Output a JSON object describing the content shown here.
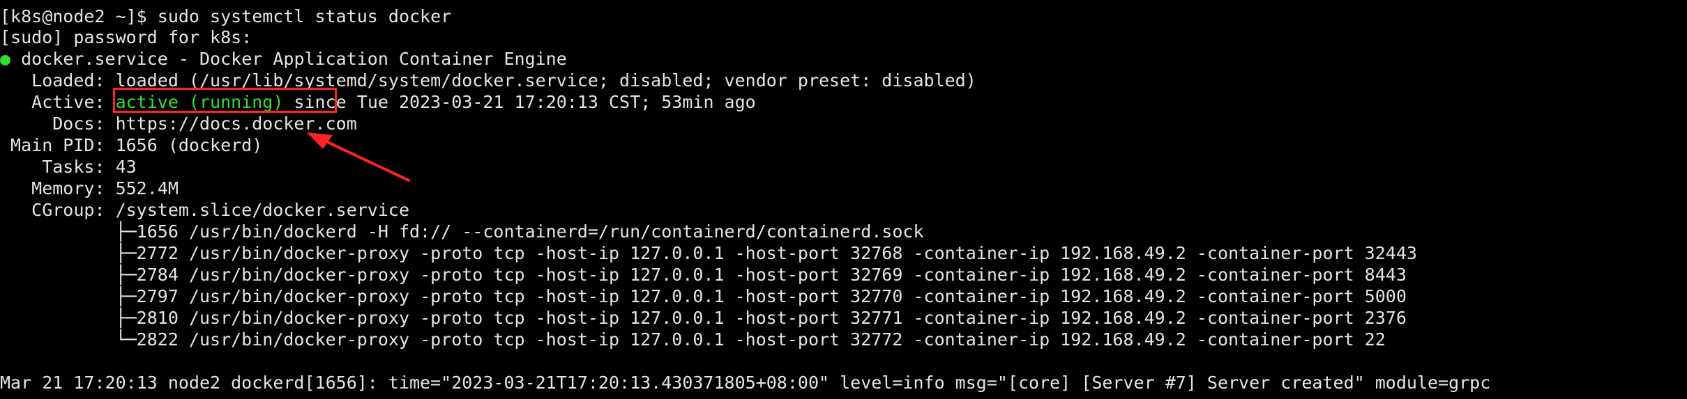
{
  "terminal": {
    "lines": [
      {
        "text": "[k8s@node2 ~]$ sudo systemctl status docker"
      },
      {
        "text": "[sudo] password for k8s:"
      },
      {
        "bullet": "●",
        "text": " docker.service - Docker Application Container Engine"
      },
      {
        "text": "   Loaded: loaded (/usr/lib/systemd/system/docker.service; disabled; vendor preset: disabled)"
      },
      {
        "prefix": "   Active: ",
        "status": "active (running)",
        "suffix": " since Tue 2023-03-21 17:20:13 CST; 53min ago"
      },
      {
        "text": "     Docs: https://docs.docker.com"
      },
      {
        "text": " Main PID: 1656 (dockerd)"
      },
      {
        "text": "    Tasks: 43"
      },
      {
        "text": "   Memory: 552.4M"
      },
      {
        "text": "   CGroup: /system.slice/docker.service"
      },
      {
        "text": "           ├─1656 /usr/bin/dockerd -H fd:// --containerd=/run/containerd/containerd.sock"
      },
      {
        "text": "           ├─2772 /usr/bin/docker-proxy -proto tcp -host-ip 127.0.0.1 -host-port 32768 -container-ip 192.168.49.2 -container-port 32443"
      },
      {
        "text": "           ├─2784 /usr/bin/docker-proxy -proto tcp -host-ip 127.0.0.1 -host-port 32769 -container-ip 192.168.49.2 -container-port 8443"
      },
      {
        "text": "           ├─2797 /usr/bin/docker-proxy -proto tcp -host-ip 127.0.0.1 -host-port 32770 -container-ip 192.168.49.2 -container-port 5000"
      },
      {
        "text": "           ├─2810 /usr/bin/docker-proxy -proto tcp -host-ip 127.0.0.1 -host-port 32771 -container-ip 192.168.49.2 -container-port 2376"
      },
      {
        "text": "           └─2822 /usr/bin/docker-proxy -proto tcp -host-ip 127.0.0.1 -host-port 32772 -container-ip 192.168.49.2 -container-port 22"
      },
      {
        "text": ""
      },
      {
        "text": "Mar 21 17:20:13 node2 dockerd[1656]: time=\"2023-03-21T17:20:13.430371805+08:00\" level=info msg=\"[core] [Server #7] Server created\" module=grpc"
      }
    ]
  },
  "colors": {
    "background": "#000000",
    "text": "#e4e4e4",
    "green": "#32e032",
    "annotation": "#ff2424"
  }
}
